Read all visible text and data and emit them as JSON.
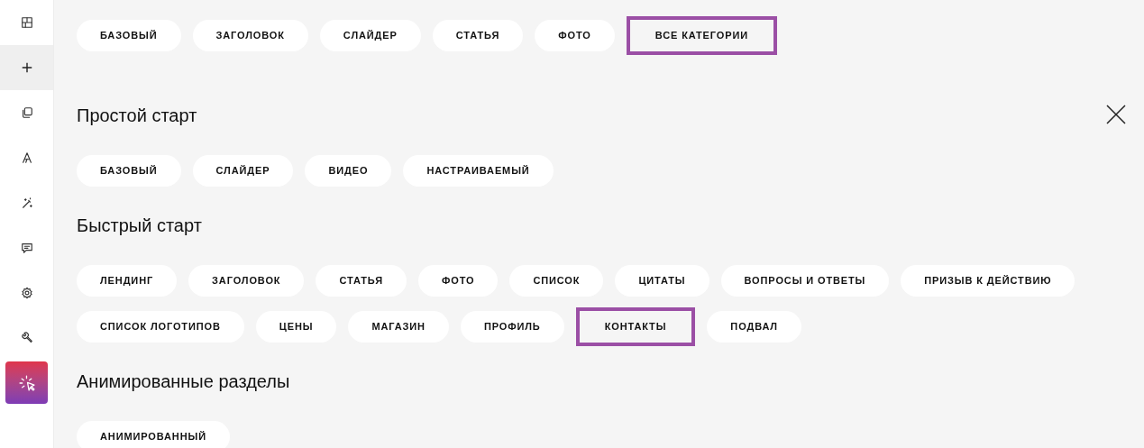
{
  "sidebar": {
    "items": [
      {
        "selected": false
      },
      {
        "selected": true
      },
      {
        "selected": false
      },
      {
        "selected": false
      },
      {
        "selected": false
      },
      {
        "selected": false
      },
      {
        "selected": false
      },
      {
        "selected": false
      },
      {
        "selected": false
      }
    ]
  },
  "top_filters": [
    {
      "label": "БАЗОВЫЙ",
      "highlighted": false
    },
    {
      "label": "ЗАГОЛОВОК",
      "highlighted": false
    },
    {
      "label": "СЛАЙДЕР",
      "highlighted": false
    },
    {
      "label": "СТАТЬЯ",
      "highlighted": false
    },
    {
      "label": "ФОТО",
      "highlighted": false
    },
    {
      "label": "ВСЕ КАТЕГОРИИ",
      "highlighted": true
    }
  ],
  "sections": [
    {
      "title": "Простой старт",
      "chips": [
        {
          "label": "БАЗОВЫЙ",
          "highlighted": false
        },
        {
          "label": "СЛАЙДЕР",
          "highlighted": false
        },
        {
          "label": "ВИДЕО",
          "highlighted": false
        },
        {
          "label": "НАСТРАИВАЕМЫЙ",
          "highlighted": false
        }
      ]
    },
    {
      "title": "Быстрый старт",
      "chips": [
        {
          "label": "ЛЕНДИНГ",
          "highlighted": false
        },
        {
          "label": "ЗАГОЛОВОК",
          "highlighted": false
        },
        {
          "label": "СТАТЬЯ",
          "highlighted": false
        },
        {
          "label": "ФОТО",
          "highlighted": false
        },
        {
          "label": "СПИСОК",
          "highlighted": false
        },
        {
          "label": "ЦИТАТЫ",
          "highlighted": false
        },
        {
          "label": "ВОПРОСЫ И ОТВЕТЫ",
          "highlighted": false
        },
        {
          "label": "ПРИЗЫВ К ДЕЙСТВИЮ",
          "highlighted": false
        },
        {
          "label": "СПИСОК ЛОГОТИПОВ",
          "highlighted": false
        },
        {
          "label": "ЦЕНЫ",
          "highlighted": false
        },
        {
          "label": "МАГАЗИН",
          "highlighted": false
        },
        {
          "label": "ПРОФИЛЬ",
          "highlighted": false
        },
        {
          "label": "КОНТАКТЫ",
          "highlighted": true
        },
        {
          "label": "ПОДВАЛ",
          "highlighted": false
        }
      ]
    },
    {
      "title": "Анимированные разделы",
      "chips": [
        {
          "label": "АНИМИРОВАННЫЙ",
          "highlighted": false
        }
      ]
    }
  ]
}
